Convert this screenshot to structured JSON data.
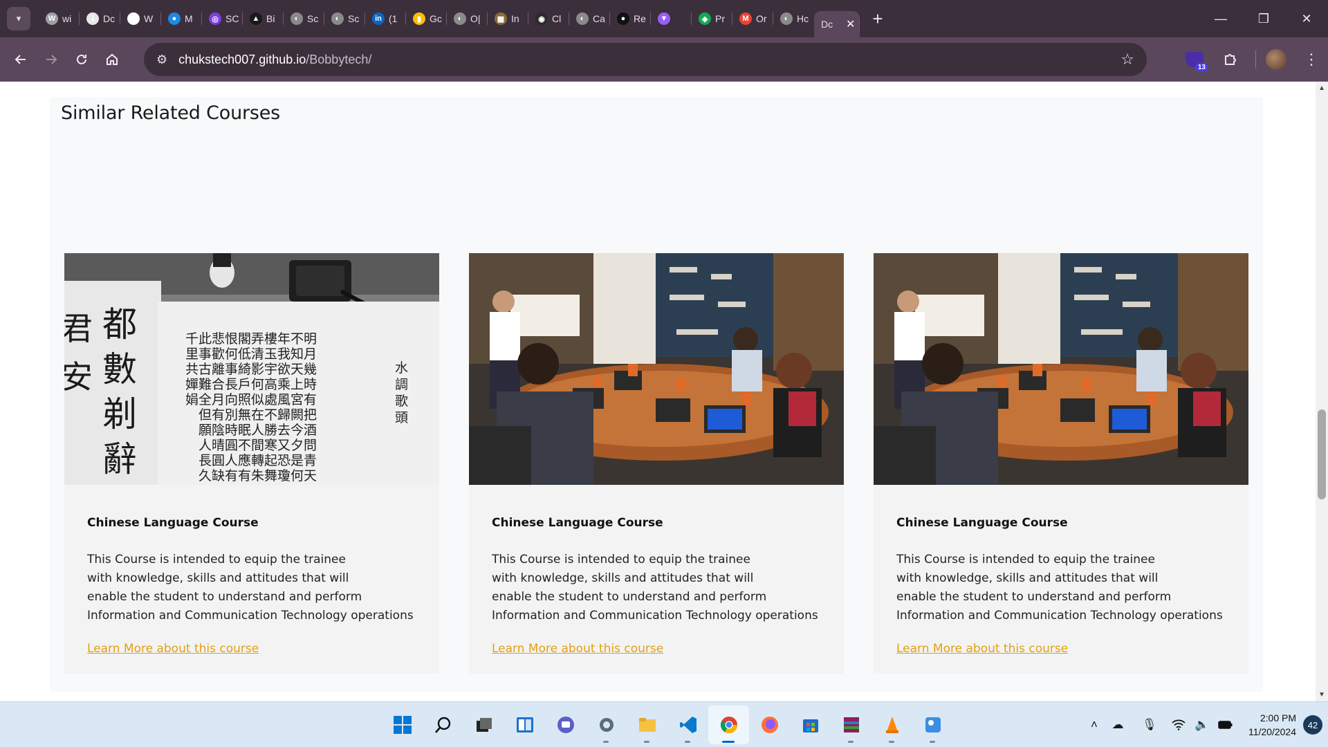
{
  "browser": {
    "tabs": [
      {
        "label": "wi",
        "icon": "wordpress-icon",
        "color": "#9aa0a6"
      },
      {
        "label": "Dc",
        "icon": "download-icon",
        "color": "#e8e8e8"
      },
      {
        "label": "W",
        "icon": "openai-icon",
        "color": "#ffffff"
      },
      {
        "label": "M",
        "icon": "app-icon",
        "color": "#1e88e5"
      },
      {
        "label": "SC",
        "icon": "web3-icon",
        "color": "#7b3fe4"
      },
      {
        "label": "Bi",
        "icon": "bitcoin-icon",
        "color": "#1a1a1a"
      },
      {
        "label": "Sc",
        "icon": "globe-icon",
        "color": "#8a8a8a"
      },
      {
        "label": "Sc",
        "icon": "globe-icon",
        "color": "#8a8a8a"
      },
      {
        "label": "(1",
        "icon": "linkedin-icon",
        "color": "#0a66c2"
      },
      {
        "label": "Gc",
        "icon": "keep-icon",
        "color": "#fbbc04"
      },
      {
        "label": "O|",
        "icon": "globe-icon",
        "color": "#8a8a8a"
      },
      {
        "label": "In",
        "icon": "image-icon",
        "color": "#8a6a3a"
      },
      {
        "label": "Cl",
        "icon": "github-icon",
        "color": "#2b2b2b"
      },
      {
        "label": "Ca",
        "icon": "globe-icon",
        "color": "#8a8a8a"
      },
      {
        "label": "Re",
        "icon": "app-icon",
        "color": "#111111"
      },
      {
        "label": "",
        "icon": "vite-icon",
        "color": "#9a5cf5"
      },
      {
        "label": "Pr",
        "icon": "mongodb-icon",
        "color": "#13aa52"
      },
      {
        "label": "Or",
        "icon": "gmail-icon",
        "color": "#ea4335"
      },
      {
        "label": "Hc",
        "icon": "globe-icon",
        "color": "#8a8a8a"
      }
    ],
    "active_tab": {
      "label": "Dc",
      "close": "✕"
    },
    "new_tab": "+",
    "window_controls": {
      "minimize": "—",
      "restore": "❐",
      "close": "✕"
    },
    "url_host": "chukstech007.github.io",
    "url_path": "/Bobbytech/",
    "extension_badge": "13"
  },
  "page": {
    "section_title": "Similar Related Courses",
    "cards": [
      {
        "image": "chinese-calligraphy-image",
        "title": "Chinese Language Course",
        "description": [
          "This Course is intended to equip the trainee",
          "with knowledge, skills and attitudes that will",
          "enable the student to understand and perform",
          "Information and Communication Technology operations"
        ],
        "link": "Learn More about this course"
      },
      {
        "image": "meeting-room-image",
        "title": "Chinese Language Course",
        "description": [
          "This Course is intended to equip the trainee",
          "with knowledge, skills and attitudes that will",
          "enable the student to understand and perform",
          "Information and Communication Technology operations"
        ],
        "link": "Learn More about this course"
      },
      {
        "image": "meeting-room-image",
        "title": "Chinese Language Course",
        "description": [
          "This Course is intended to equip the trainee",
          "with knowledge, skills and attitudes that will",
          "enable the student to understand and perform",
          "Information and Communication Technology operations"
        ],
        "link": "Learn More about this course"
      }
    ],
    "link_color": "#e2a012"
  },
  "taskbar": {
    "apps": [
      {
        "name": "start-icon",
        "active": false
      },
      {
        "name": "search-icon",
        "active": false
      },
      {
        "name": "task-view-icon",
        "active": false
      },
      {
        "name": "widgets-icon",
        "active": false
      },
      {
        "name": "teams-chat-icon",
        "active": false
      },
      {
        "name": "settings-icon",
        "active": false,
        "running": true
      },
      {
        "name": "file-explorer-icon",
        "active": false,
        "running": true
      },
      {
        "name": "vscode-icon",
        "active": false,
        "running": true
      },
      {
        "name": "chrome-icon",
        "active": true,
        "running": true
      },
      {
        "name": "firefox-icon",
        "active": false
      },
      {
        "name": "microsoft-store-icon",
        "active": false
      },
      {
        "name": "winrar-icon",
        "active": false,
        "running": true
      },
      {
        "name": "vlc-icon",
        "active": false,
        "running": true
      },
      {
        "name": "paint-icon",
        "active": false,
        "running": true
      }
    ],
    "time": "2:00 PM",
    "date": "11/20/2024",
    "notifications": "42"
  }
}
